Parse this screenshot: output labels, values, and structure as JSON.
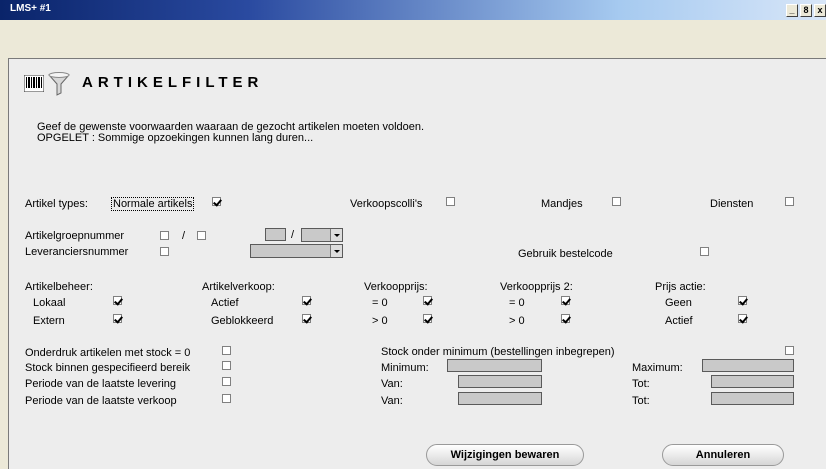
{
  "window": {
    "title": "LMS+  #1",
    "buttons": [
      "_",
      "8",
      "x"
    ]
  },
  "header": {
    "title": "ARTIKELFILTER",
    "icons": [
      "barcode-icon",
      "funnel-icon"
    ]
  },
  "intro": {
    "line1": "Geef de gewenste voorwaarden waaraan de gezocht artikelen moeten voldoen.",
    "line2": "OPGELET : Sommige opzoekingen kunnen lang duren..."
  },
  "types": {
    "label": "Artikel types:",
    "normale": {
      "label": "Normale artikels",
      "checked": true
    },
    "verkoopscollis": {
      "label": "Verkoopscolli's",
      "checked": false
    },
    "mandjes": {
      "label": "Mandjes",
      "checked": false
    },
    "diensten": {
      "label": "Diensten",
      "checked": false
    }
  },
  "artikelgroep": {
    "label": "Artikelgroepnummer",
    "sep1": "/",
    "sep2": "/"
  },
  "leverancier": {
    "label": "Leveranciersnummer"
  },
  "bestelcode": {
    "label": "Gebruik bestelcode",
    "checked": false
  },
  "beheer": {
    "label": "Artikelbeheer:",
    "lokaal": {
      "label": "Lokaal",
      "checked": true
    },
    "extern": {
      "label": "Extern",
      "checked": true
    }
  },
  "verkoop": {
    "label": "Artikelverkoop:",
    "actief": {
      "label": "Actief",
      "checked": true
    },
    "geblokkeerd": {
      "label": "Geblokkeerd",
      "checked": true
    }
  },
  "prijs": {
    "label": "Verkoopprijs:",
    "eq0": {
      "label": "= 0",
      "checked": true
    },
    "gt0": {
      "label": "> 0",
      "checked": true
    }
  },
  "prijs2": {
    "label": "Verkoopprijs 2:",
    "eq0": {
      "label": "= 0",
      "checked": true
    },
    "gt0": {
      "label": "> 0",
      "checked": true
    }
  },
  "actie": {
    "label": "Prijs actie:",
    "geen": {
      "label": "Geen",
      "checked": true
    },
    "actief": {
      "label": "Actief",
      "checked": true
    }
  },
  "stock": {
    "onderdruk": "Onderdruk artikelen met stock = 0",
    "bereik": "Stock binnen gespecifieerd bereik",
    "levering": "Periode van de laatste levering",
    "verkoop": "Periode van de laatste verkoop",
    "onder_min": "Stock onder minimum (bestellingen inbegrepen)",
    "minimum": "Minimum:",
    "maximum": "Maximum:",
    "van": "Van:",
    "tot": "Tot:"
  },
  "actions": {
    "save": "Wijzigingen bewaren",
    "cancel": "Annuleren"
  }
}
